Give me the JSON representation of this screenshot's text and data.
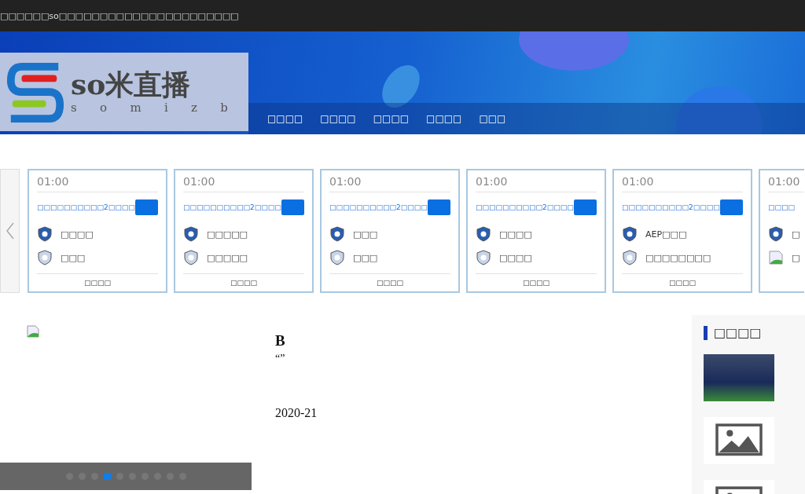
{
  "top_bar": {
    "text": "□□□□□□so□□□□□□□□□□□□□□□□□□□□□□"
  },
  "header": {
    "logo_text": "so米直播",
    "logo_subtitle": [
      "s",
      "o",
      "m",
      "i",
      "z",
      "b"
    ],
    "nav": [
      {
        "label": "□□□□"
      },
      {
        "label": "□□□□"
      },
      {
        "label": "□□□□"
      },
      {
        "label": "□□□□"
      },
      {
        "label": "□□□"
      }
    ]
  },
  "matches": [
    {
      "time": "01:00",
      "league": "□□□□□□□□□□2□□□□",
      "teams": [
        {
          "name": "□□□□",
          "kind": "crest"
        },
        {
          "name": "□□□",
          "kind": "crest"
        }
      ],
      "footer": "□□□□"
    },
    {
      "time": "01:00",
      "league": "□□□□□□□□□□2□□□□",
      "teams": [
        {
          "name": "□□□□□",
          "kind": "crest"
        },
        {
          "name": "□□□□□",
          "kind": "crest"
        }
      ],
      "footer": "□□□□"
    },
    {
      "time": "01:00",
      "league": "□□□□□□□□□□2□□□□",
      "teams": [
        {
          "name": "□□□",
          "kind": "crest"
        },
        {
          "name": "□□□",
          "kind": "crest"
        }
      ],
      "footer": "□□□□"
    },
    {
      "time": "01:00",
      "league": "□□□□□□□□□□2□□□□",
      "teams": [
        {
          "name": "□□□□",
          "kind": "crest"
        },
        {
          "name": "□□□□",
          "kind": "crest"
        }
      ],
      "footer": "□□□□"
    },
    {
      "time": "01:00",
      "league": "□□□□□□□□□□2□□□□",
      "teams": [
        {
          "name": "AEP□□□",
          "kind": "crest"
        },
        {
          "name": "□□□□□□□□",
          "kind": "crest"
        }
      ],
      "footer": "□□□□"
    },
    {
      "time": "01:00",
      "league": "□□□□",
      "teams": [
        {
          "name": "□",
          "kind": "crest"
        },
        {
          "name": "□",
          "kind": "broken"
        }
      ]
    }
  ],
  "slider": {
    "dots": [
      {
        "selected": false
      },
      {
        "selected": false
      },
      {
        "selected": false
      },
      {
        "selected": true
      },
      {
        "selected": false
      },
      {
        "selected": false
      },
      {
        "selected": false
      },
      {
        "selected": false
      },
      {
        "selected": false
      },
      {
        "selected": false
      }
    ]
  },
  "article": {
    "title": "B",
    "quote": "“”",
    "date": "2020-21"
  },
  "sidebar": {
    "title": "□□□□",
    "thumbnails": [
      {
        "kind": "photo"
      },
      {
        "kind": "no-image"
      },
      {
        "kind": "no-image"
      }
    ]
  }
}
